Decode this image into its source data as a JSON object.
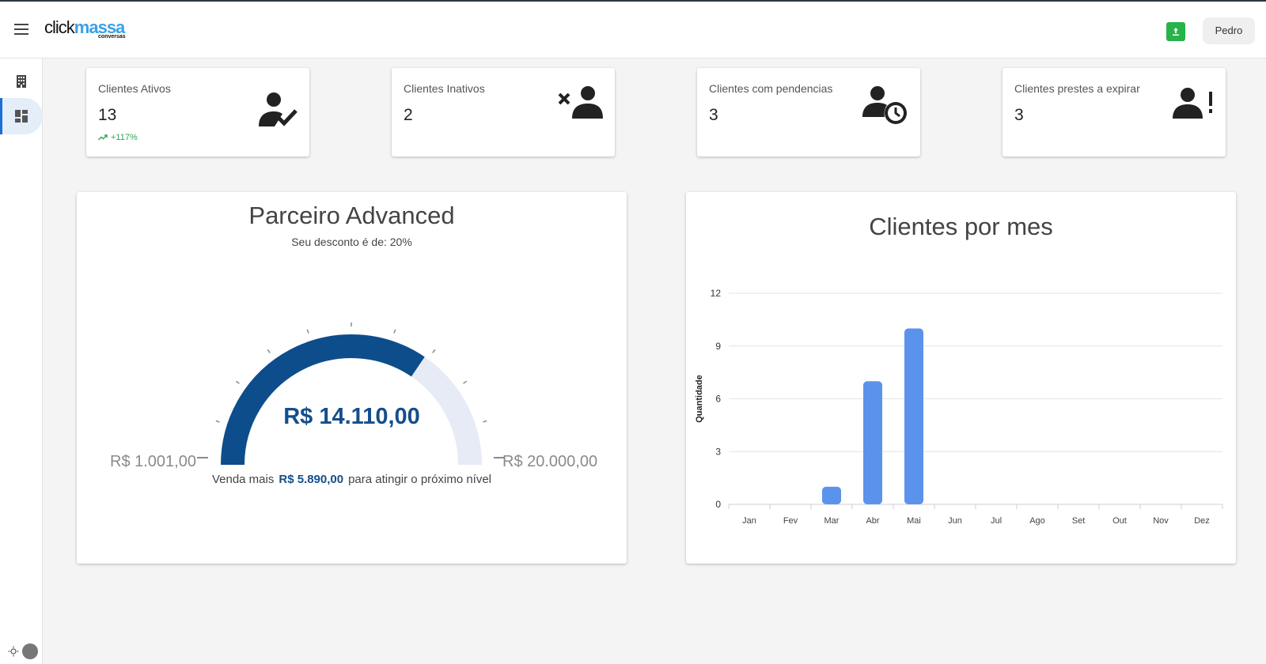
{
  "header": {
    "logo_main": "click",
    "logo_accent": "massa",
    "logo_sub": "conversas",
    "user_label": "Pedro"
  },
  "sidebar": {
    "items": [
      {
        "icon": "building-icon"
      },
      {
        "icon": "dashboard-icon",
        "active": true
      }
    ]
  },
  "stats": [
    {
      "label": "Clientes Ativos",
      "value": "13",
      "trend": "+117%",
      "icon": "user-check-icon"
    },
    {
      "label": "Clientes Inativos",
      "value": "2",
      "icon": "user-remove-icon"
    },
    {
      "label": "Clientes com pendencias",
      "value": "3",
      "icon": "user-clock-icon"
    },
    {
      "label": "Clientes prestes a expirar",
      "value": "3",
      "icon": "user-alert-icon"
    }
  ],
  "partner": {
    "title": "Parceiro Advanced",
    "discount": "Seu desconto é de: 20%",
    "min_label": "R$ 1.001,00",
    "max_label": "R$ 20.000,00",
    "current_label": "R$ 14.110,00",
    "min": 1001,
    "max": 20000,
    "current": 14110,
    "foot_prefix": "Venda mais",
    "foot_amount": "R$ 5.890,00",
    "foot_suffix": "para atingir o próximo nível",
    "colors": {
      "fill": "#0d4d8c",
      "track": "#e6ebf6"
    }
  },
  "chart_data": {
    "type": "bar",
    "title": "Clientes por mes",
    "ylabel": "Quantidade",
    "xlabel": "",
    "categories": [
      "Jan",
      "Fev",
      "Mar",
      "Abr",
      "Mai",
      "Jun",
      "Jul",
      "Ago",
      "Set",
      "Out",
      "Nov",
      "Dez"
    ],
    "values": [
      0,
      0,
      1,
      7,
      10,
      0,
      0,
      0,
      0,
      0,
      0,
      0
    ],
    "yticks": [
      0,
      3,
      6,
      9,
      12
    ],
    "ylim": [
      0,
      12
    ],
    "grid": true,
    "color": "#5b93ec"
  }
}
